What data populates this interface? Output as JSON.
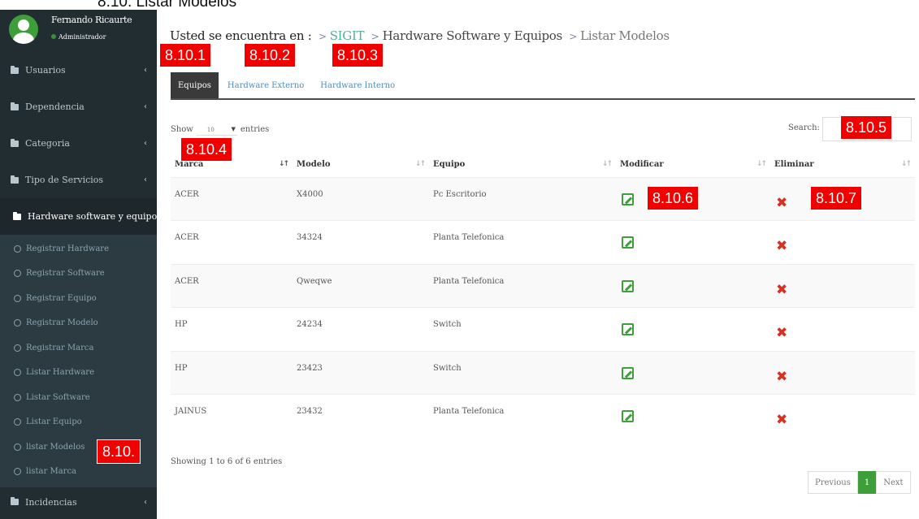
{
  "doc_heading": "8.10.   Listar Modelos",
  "user": {
    "name": "Fernando Ricaurte",
    "role": "Administrador"
  },
  "sidebar": {
    "items": [
      {
        "label": "Usuarios",
        "chevron": "‹"
      },
      {
        "label": "Dependencia",
        "chevron": "‹"
      },
      {
        "label": "Categoria",
        "chevron": "‹"
      },
      {
        "label": "Tipo de Servicios",
        "chevron": "‹"
      },
      {
        "label": "Hardware software y equipo",
        "chevron": "⌄"
      }
    ],
    "sub_items": [
      "Registrar Hardware",
      "Registrar Software",
      "Registrar Equipo",
      "Registrar Modelo",
      "Registrar Marca",
      "Listar Hardware",
      "Listar Software",
      "Listar Equipo",
      "listar Modelos",
      "listar Marca"
    ],
    "bottom_item": {
      "label": "Incidencias",
      "chevron": "‹"
    }
  },
  "breadcrumb": {
    "lead": "Usted se encuentra en :",
    "sep": ">",
    "link": "SIGIT",
    "section": "Hardware Software y Equipos",
    "current": "Listar Modelos"
  },
  "tabs": [
    "Equipos",
    "Hardware Externo",
    "Hardware Interno"
  ],
  "datatable": {
    "show_label": "Show",
    "page_size": "10",
    "entries_label": "entries",
    "search_label": "Search:",
    "columns": [
      "Marca",
      "Modelo",
      "Equipo",
      "Modificar",
      "Eliminar"
    ],
    "rows": [
      {
        "marca": "ACER",
        "modelo": "X4000",
        "equipo": "Pc Escritorio"
      },
      {
        "marca": "ACER",
        "modelo": "34324",
        "equipo": "Planta Telefonica"
      },
      {
        "marca": "ACER",
        "modelo": "Qweqwe",
        "equipo": "Planta Telefonica"
      },
      {
        "marca": "HP",
        "modelo": "24234",
        "equipo": "Switch"
      },
      {
        "marca": "HP",
        "modelo": "23423",
        "equipo": "Switch"
      },
      {
        "marca": "JAINUS",
        "modelo": "23432",
        "equipo": "Planta Telefonica"
      }
    ],
    "info": "Showing 1 to 6 of 6 entries",
    "pagination": {
      "previous": "Previous",
      "page": "1",
      "next": "Next"
    }
  },
  "callouts": {
    "c1": "8.10.1",
    "c2": "8.10.2",
    "c3": "8.10.3",
    "c4": "8.10.4",
    "c5": "8.10.5",
    "c6": "8.10.6",
    "c7": "8.10.7",
    "c8": "8.10."
  },
  "colors": {
    "sidebar_bg": "#222d32",
    "accent_green": "#3e9f3a",
    "delete_red": "#d9301f",
    "callout_red": "#f10000"
  }
}
